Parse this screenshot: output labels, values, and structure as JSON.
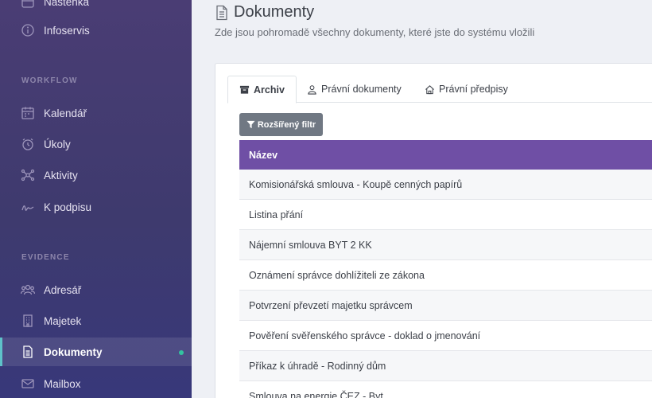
{
  "sidebar": {
    "items": [
      {
        "key": "nastenka",
        "label": "Nástěnka",
        "icon": "dashboard-icon"
      },
      {
        "key": "infoservis",
        "label": "Infoservis",
        "icon": "info-icon"
      },
      {
        "key": "kalendar",
        "label": "Kalendář",
        "icon": "calendar-icon"
      },
      {
        "key": "ukoly",
        "label": "Úkoly",
        "icon": "alarm-clock-icon"
      },
      {
        "key": "aktivity",
        "label": "Aktivity",
        "icon": "network-icon"
      },
      {
        "key": "k_podpisu",
        "label": "K podpisu",
        "icon": "signature-icon"
      },
      {
        "key": "adresar",
        "label": "Adresář",
        "icon": "users-icon"
      },
      {
        "key": "majetek",
        "label": "Majetek",
        "icon": "building-icon"
      },
      {
        "key": "dokumenty",
        "label": "Dokumenty",
        "icon": "document-icon"
      },
      {
        "key": "mailbox",
        "label": "Mailbox",
        "icon": "envelope-icon"
      }
    ],
    "sections": {
      "workflow": "WORKFLOW",
      "evidence": "EVIDENCE"
    }
  },
  "header": {
    "title": "Dokumenty",
    "subtitle": "Zde jsou pohromadě všechny dokumenty, které jste do systému vložili"
  },
  "tabs": [
    {
      "label": "Archiv",
      "icon": "archive-icon",
      "active": true
    },
    {
      "label": "Právní dokumenty",
      "icon": "person-icon",
      "active": false
    },
    {
      "label": "Právní předpisy",
      "icon": "home-icon",
      "active": false
    }
  ],
  "toolbar": {
    "filter_label": "Rozšířený filtr"
  },
  "table": {
    "header": "Název",
    "rows": [
      "Komisionářská smlouva - Koupě cenných papírů",
      "Listina přání",
      "Nájemní smlouva BYT 2 KK",
      "Oznámení správce dohlížiteli ze zákona",
      "Potvrzení převzetí majetku správcem",
      "Pověření svěřenského správce - doklad o jmenování",
      "Příkaz k úhradě - Rodinný dům",
      "Smlouva na energie ČEZ - Byt"
    ]
  },
  "colors": {
    "sidebar": "#45397a",
    "table_header": "#6f4fa5",
    "filter_button": "#707883",
    "active_dot": "#33c3a0"
  }
}
